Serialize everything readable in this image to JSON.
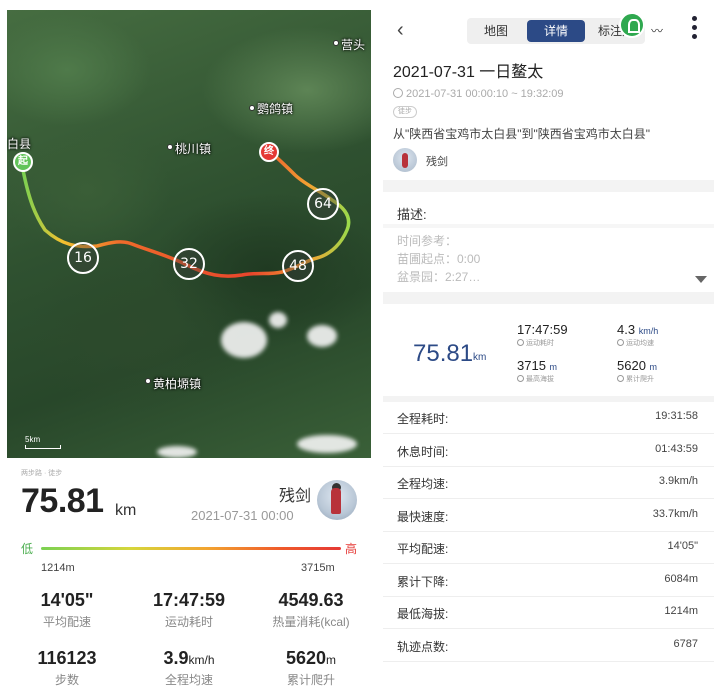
{
  "map": {
    "labels": {
      "baixian": "白县",
      "taochuanzhen": "桃川镇",
      "yingezhen": "鹦鸽镇",
      "huangbaiyuanzhen": "黄柏塬镇",
      "yingtou": "营头"
    },
    "start_pin": "起",
    "end_pin": "终",
    "km_markers": [
      "16",
      "32",
      "48",
      "64"
    ],
    "scale": "5km"
  },
  "summary": {
    "sub_label": "两步路 · 徒步",
    "distance_value": "75.81",
    "distance_unit": "km",
    "user_name": "残剑",
    "date": "2021-07-31 00:00",
    "low_label": "低",
    "high_label": "高",
    "min_elevation": "1214m",
    "max_elevation": "3715m",
    "stats": [
      {
        "value": "14'05\"",
        "unit": "",
        "label": "平均配速"
      },
      {
        "value": "17:47:59",
        "unit": "",
        "label": "运动耗时"
      },
      {
        "value": "4549.63",
        "unit": "",
        "label": "热量消耗(kcal)"
      },
      {
        "value": "116123",
        "unit": "",
        "label": "步数"
      },
      {
        "value": "3.9",
        "unit": "km/h",
        "label": "全程均速"
      },
      {
        "value": "5620",
        "unit": "m",
        "label": "累计爬升"
      }
    ]
  },
  "detail": {
    "tabs": [
      "地图",
      "详情",
      "标注点"
    ],
    "active_tab": "详情",
    "title": "2021-07-31 一日鳌太",
    "time_range": "2021-07-31 00:00:10 ~ 19:32:09",
    "tag": "徒步",
    "route_desc": "从\"陕西省宝鸡市太白县\"到\"陕西省宝鸡市太白县\"",
    "author": "残剑",
    "desc_heading": "描述:",
    "desc_lines": [
      "时间参考：",
      "苗圃起点：0:00",
      "盆景园：2:27…"
    ],
    "big_distance": "75.81",
    "big_distance_unit": "km",
    "mini_stats": [
      {
        "value": "17:47:59",
        "unit": "",
        "label": "运动耗时"
      },
      {
        "value": "4.3",
        "unit": "km/h",
        "label": "运动均速"
      },
      {
        "value": "3715",
        "unit": "m",
        "label": "最高海拔"
      },
      {
        "value": "5620",
        "unit": "m",
        "label": "累计爬升"
      }
    ],
    "rows": [
      {
        "label": "全程耗时:",
        "value": "19:31:58"
      },
      {
        "label": "休息时间:",
        "value": "01:43:59"
      },
      {
        "label": "全程均速:",
        "value": "3.9km/h"
      },
      {
        "label": "最快速度:",
        "value": "33.7km/h"
      },
      {
        "label": "平均配速:",
        "value": "14'05\""
      },
      {
        "label": "累计下降:",
        "value": "6084m"
      },
      {
        "label": "最低海拔:",
        "value": "1214m"
      },
      {
        "label": "轨迹点数:",
        "value": "6787"
      }
    ]
  },
  "colors": {
    "accent": "#2c4a86",
    "start_pin": "#62c45a",
    "end_pin": "#e53935",
    "elevation_low": "#4caf50",
    "elevation_high": "#e53935"
  }
}
